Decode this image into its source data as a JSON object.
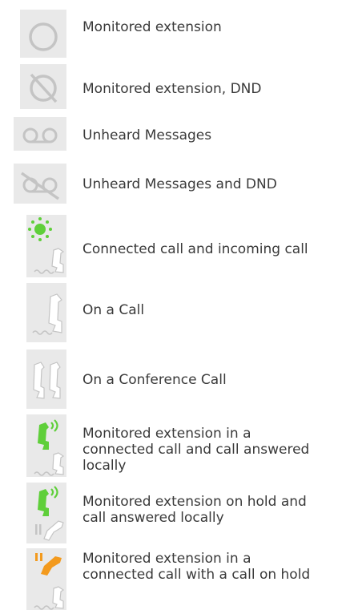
{
  "legend": [
    {
      "icon": "circle-icon",
      "label": "Monitored extension"
    },
    {
      "icon": "circle-slashed-icon",
      "label": "Monitored extension, DND"
    },
    {
      "icon": "voicemail-icon",
      "label": "Unheard Messages"
    },
    {
      "icon": "voicemail-slashed-icon",
      "label": "Unheard Messages and DND"
    },
    {
      "icon": "ringing-handset-icon",
      "label": "Connected call and incoming call"
    },
    {
      "icon": "handset-icon",
      "label": "On a Call"
    },
    {
      "icon": "conference-handset-icon",
      "label": "On a Conference Call"
    },
    {
      "icon": "answered-locally-icon",
      "lines": [
        "Monitored extension in a",
        "connected call and call answered",
        "locally"
      ]
    },
    {
      "icon": "hold-answered-locally-icon",
      "lines": [
        "Monitored extension on hold and",
        "call answered locally"
      ]
    },
    {
      "icon": "call-on-hold-icon",
      "lines": [
        "Monitored extension in a",
        "connected call with a call on hold"
      ]
    }
  ],
  "colors": {
    "tile": "#e9e9e9",
    "grey_glyph": "#c4c4c4",
    "green": "#5fcf3a",
    "orange": "#f39a1d",
    "text": "#3a3a3a"
  }
}
